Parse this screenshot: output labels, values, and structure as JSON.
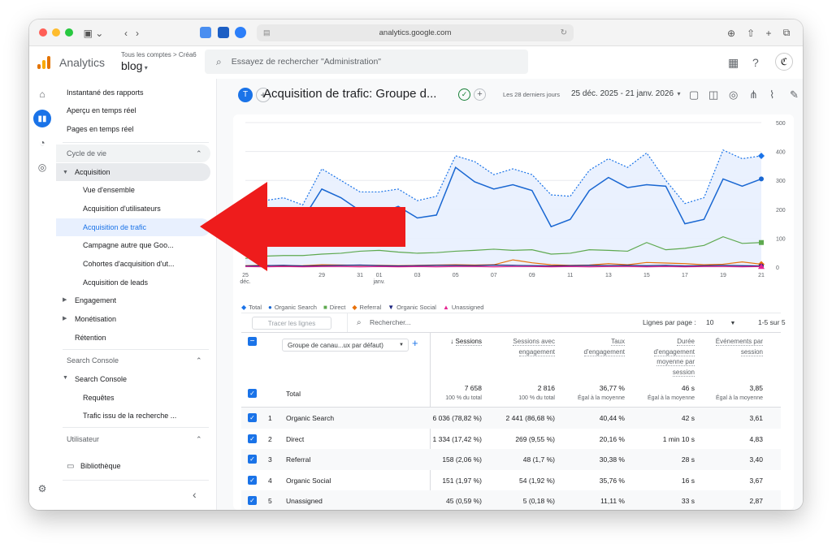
{
  "browser": {
    "url": "analytics.google.com"
  },
  "header": {
    "brand": "Analytics",
    "breadcrumb": "Tous les comptes > Créa6",
    "property": "blog",
    "search_placeholder": "Essayez de rechercher \"Administration\""
  },
  "sidebar": {
    "items": [
      {
        "label": "Instantané des rapports"
      },
      {
        "label": "Aperçu en temps réel"
      },
      {
        "label": "Pages en temps réel"
      }
    ],
    "section_lifecycle": "Cycle de vie",
    "acquisition": "Acquisition",
    "acquisition_items": [
      {
        "label": "Vue d'ensemble"
      },
      {
        "label": "Acquisition d'utilisateurs"
      },
      {
        "label": "Acquisition de trafic"
      },
      {
        "label": "Campagne autre que Goo..."
      },
      {
        "label": "Cohortes d'acquisition d'ut..."
      },
      {
        "label": "Acquisition de leads"
      }
    ],
    "engagement": "Engagement",
    "monetisation": "Monétisation",
    "retention": "Rétention",
    "section_search_console": "Search Console",
    "search_console": "Search Console",
    "search_console_items": [
      {
        "label": "Requêtes"
      },
      {
        "label": "Trafic issu de la recherche ..."
      }
    ],
    "section_user": "Utilisateur",
    "library": "Bibliothèque"
  },
  "toolbar": {
    "avatar": "T",
    "title": "Acquisition de trafic: Groupe d...",
    "range_label": "Les 28 derniers jours",
    "range": "25 déc. 2025 - 21 janv. 2026"
  },
  "chart_data": {
    "type": "line",
    "x": [
      "25 déc.",
      "26",
      "27",
      "28",
      "29",
      "30",
      "31",
      "01 janv.",
      "02",
      "03",
      "04",
      "05",
      "06",
      "07",
      "08",
      "09",
      "10",
      "11",
      "12",
      "13",
      "14",
      "15",
      "16",
      "17",
      "18",
      "19",
      "20",
      "21"
    ],
    "x_tick_labels": [
      "25",
      "déc.",
      "29",
      "31",
      "01",
      "janv.",
      "03",
      "05",
      "07",
      "09",
      "11",
      "13",
      "15",
      "17",
      "19",
      "21"
    ],
    "y_ticks": [
      "0",
      "100",
      "200",
      "300",
      "400",
      "500"
    ],
    "ylim": [
      0,
      500
    ],
    "series": [
      {
        "name": "Total",
        "color": "#1a73e8",
        "values": [
          190,
          230,
          240,
          215,
          340,
          300,
          260,
          260,
          270,
          230,
          245,
          385,
          365,
          320,
          340,
          320,
          250,
          245,
          335,
          375,
          345,
          395,
          300,
          220,
          240,
          405,
          375,
          385
        ]
      },
      {
        "name": "Organic Search",
        "color": "#1967d2",
        "values": [
          160,
          190,
          185,
          165,
          270,
          240,
          195,
          185,
          210,
          170,
          180,
          345,
          295,
          270,
          285,
          265,
          140,
          165,
          265,
          310,
          275,
          285,
          280,
          150,
          165,
          305,
          280,
          305
        ]
      },
      {
        "name": "Direct",
        "color": "#5ea94f",
        "values": [
          30,
          38,
          40,
          40,
          45,
          48,
          55,
          58,
          52,
          48,
          50,
          55,
          58,
          62,
          58,
          60,
          45,
          48,
          60,
          58,
          55,
          85,
          60,
          65,
          75,
          105,
          82,
          85
        ]
      },
      {
        "name": "Referral",
        "color": "#e8710a",
        "values": [
          5,
          6,
          4,
          5,
          8,
          7,
          6,
          6,
          5,
          6,
          7,
          8,
          7,
          8,
          25,
          15,
          8,
          6,
          7,
          12,
          8,
          16,
          14,
          12,
          8,
          10,
          18,
          10
        ]
      },
      {
        "name": "Organic Social",
        "color": "#1a237e",
        "values": [
          4,
          5,
          6,
          4,
          5,
          6,
          7,
          5,
          4,
          5,
          6,
          6,
          5,
          7,
          6,
          5,
          4,
          5,
          6,
          5,
          6,
          5,
          6,
          4,
          5,
          6,
          5,
          4
        ]
      },
      {
        "name": "Unassigned",
        "color": "#e52592",
        "values": [
          2,
          1,
          2,
          1,
          2,
          2,
          1,
          2,
          1,
          2,
          1,
          2,
          2,
          1,
          2,
          2,
          1,
          2,
          1,
          2,
          2,
          1,
          2,
          1,
          2,
          2,
          1,
          2
        ]
      }
    ]
  },
  "table_controls": {
    "filter_placeholder": "Tracer les lignes",
    "search_placeholder": "Rechercher...",
    "rows_per_page_label": "Lignes par page :",
    "rows_per_page": "10",
    "pagination": "1-5 sur 5",
    "dimension": "Groupe de canau...ux par défaut)"
  },
  "table": {
    "columns": [
      "Sessions",
      "Sessions avec engagement",
      "Taux d'engagement",
      "Durée d'engagement moyenne par session",
      "Événements par session"
    ],
    "total_label": "Total",
    "totals": [
      "7 658",
      "2 816",
      "36,77 %",
      "46 s",
      "3,85"
    ],
    "totals_sub": [
      "100 % du total",
      "100 % du total",
      "Égal à la moyenne",
      "Égal à la moyenne",
      "Égal à la moyenne"
    ],
    "rows": [
      {
        "n": "1",
        "name": "Organic Search",
        "cells": [
          "6 036 (78,82 %)",
          "2 441 (86,68 %)",
          "40,44 %",
          "42 s",
          "3,61"
        ]
      },
      {
        "n": "2",
        "name": "Direct",
        "cells": [
          "1 334 (17,42 %)",
          "269 (9,55 %)",
          "20,16 %",
          "1 min 10 s",
          "4,83"
        ]
      },
      {
        "n": "3",
        "name": "Referral",
        "cells": [
          "158 (2,06 %)",
          "48 (1,7 %)",
          "30,38 %",
          "28 s",
          "3,40"
        ]
      },
      {
        "n": "4",
        "name": "Organic Social",
        "cells": [
          "151 (1,97 %)",
          "54 (1,92 %)",
          "35,76 %",
          "16 s",
          "3,67"
        ]
      },
      {
        "n": "5",
        "name": "Unassigned",
        "cells": [
          "45 (0,59 %)",
          "5 (0,18 %)",
          "11,11 %",
          "33 s",
          "2,87"
        ]
      }
    ]
  },
  "colors": {
    "accent": "#1a73e8",
    "arrow": "#ee1c1c"
  }
}
